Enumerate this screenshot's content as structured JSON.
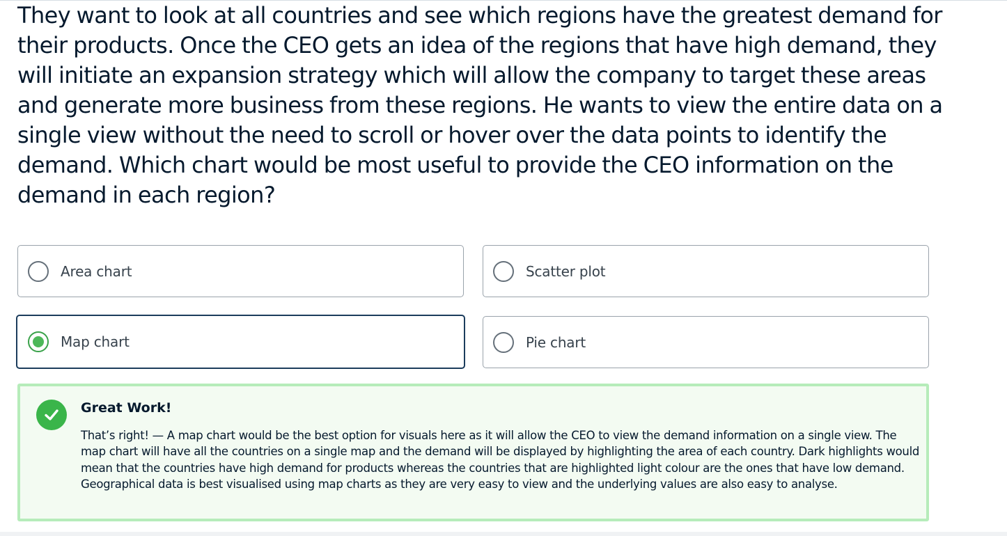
{
  "question": {
    "text": "They want to look at all countries and see which regions have the greatest demand for their products. Once the CEO gets an idea of the regions that have high demand, they will initiate an expansion strategy which will allow the company to target these areas and generate more business from these regions. He wants to view the entire data on a single view without the need to scroll or hover over the data points to identify the demand. Which chart would be most useful to provide the CEO information on the demand in each region?"
  },
  "options": [
    {
      "label": "Area chart",
      "selected": false
    },
    {
      "label": "Scatter plot",
      "selected": false
    },
    {
      "label": "Map chart",
      "selected": true
    },
    {
      "label": "Pie chart",
      "selected": false
    }
  ],
  "feedback": {
    "title": "Great Work!",
    "body": "That’s right! — A map chart would be the best option for visuals here as it will allow the CEO to view the demand information on a single view. The map chart will have all the countries on a single map and the demand will be displayed by highlighting the area of each country. Dark highlights would mean that the countries have high demand for products whereas the countries that are highlighted light colour are the ones that have low demand. Geographical data is best visualised using map charts as they are very easy to view and the underlying values are also easy to analyse.",
    "icon": "check-circle-icon"
  },
  "colors": {
    "text": "#05192d",
    "selected_border": "#1b3c5c",
    "success_green": "#3ab54a",
    "feedback_border": "#b6ecba",
    "feedback_background": "#f3fbf2"
  }
}
